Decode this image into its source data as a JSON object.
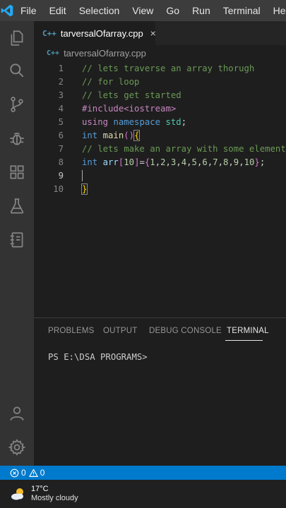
{
  "menu": {
    "items": [
      "File",
      "Edit",
      "Selection",
      "View",
      "Go",
      "Run",
      "Terminal",
      "Help"
    ]
  },
  "activity_bar": {
    "icons": [
      "explorer-icon",
      "search-icon",
      "source-control-icon",
      "run-debug-icon",
      "extensions-icon",
      "testing-icon",
      "notebook-icon"
    ],
    "bottom_icons": [
      "account-icon",
      "settings-gear-icon"
    ]
  },
  "tab": {
    "icon_text": "C++",
    "label": "tarversalOfarray.cpp",
    "close": "×"
  },
  "breadcrumb": {
    "icon_text": "C++",
    "file": "tarversalOfarray.cpp"
  },
  "editor": {
    "active_line": 9,
    "line_numbers": [
      "1",
      "2",
      "3",
      "4",
      "5",
      "6",
      "7",
      "8",
      "9",
      "10"
    ],
    "lines": [
      [
        {
          "t": "// lets traverse an array thorugh",
          "c": "cm"
        }
      ],
      [
        {
          "t": "// for loop",
          "c": "cm"
        }
      ],
      [
        {
          "t": "// lets get started",
          "c": "cm"
        }
      ],
      [
        {
          "t": "#include",
          "c": "pp"
        },
        {
          "t": "<iostream>",
          "c": "pp"
        }
      ],
      [
        {
          "t": "using",
          "c": "pp"
        },
        {
          "t": " ",
          "c": "pu"
        },
        {
          "t": "namespace",
          "c": "kw"
        },
        {
          "t": " ",
          "c": "pu"
        },
        {
          "t": "std",
          "c": "ty"
        },
        {
          "t": ";",
          "c": "pu"
        }
      ],
      [
        {
          "t": "int",
          "c": "kw"
        },
        {
          "t": " ",
          "c": "pu"
        },
        {
          "t": "main",
          "c": "fn"
        },
        {
          "t": "()",
          "c": "bb"
        },
        {
          "t": "{",
          "c": "br"
        }
      ],
      [
        {
          "t": "// lets make an array with some elements",
          "c": "cm"
        }
      ],
      [
        {
          "t": "int",
          "c": "kw"
        },
        {
          "t": " ",
          "c": "pu"
        },
        {
          "t": "arr",
          "c": "id"
        },
        {
          "t": "[",
          "c": "bb"
        },
        {
          "t": "10",
          "c": "nu"
        },
        {
          "t": "]",
          "c": "bb"
        },
        {
          "t": "=",
          "c": "pu"
        },
        {
          "t": "{",
          "c": "bb"
        },
        {
          "t": "1",
          "c": "nu"
        },
        {
          "t": ",",
          "c": "pu"
        },
        {
          "t": "2",
          "c": "nu"
        },
        {
          "t": ",",
          "c": "pu"
        },
        {
          "t": "3",
          "c": "nu"
        },
        {
          "t": ",",
          "c": "pu"
        },
        {
          "t": "4",
          "c": "nu"
        },
        {
          "t": ",",
          "c": "pu"
        },
        {
          "t": "5",
          "c": "nu"
        },
        {
          "t": ",",
          "c": "pu"
        },
        {
          "t": "6",
          "c": "nu"
        },
        {
          "t": ",",
          "c": "pu"
        },
        {
          "t": "7",
          "c": "nu"
        },
        {
          "t": ",",
          "c": "pu"
        },
        {
          "t": "8",
          "c": "nu"
        },
        {
          "t": ",",
          "c": "pu"
        },
        {
          "t": "9",
          "c": "nu"
        },
        {
          "t": ",",
          "c": "pu"
        },
        {
          "t": "10",
          "c": "nu"
        },
        {
          "t": "}",
          "c": "bb"
        },
        {
          "t": ";",
          "c": "pu"
        }
      ],
      [
        {
          "t": "",
          "c": "pu"
        }
      ],
      [
        {
          "t": "}",
          "c": "br"
        }
      ]
    ]
  },
  "panel": {
    "tabs": [
      "PROBLEMS",
      "OUTPUT",
      "DEBUG CONSOLE",
      "TERMINAL"
    ],
    "active_tab": "TERMINAL",
    "terminal_prompt": "PS E:\\DSA PROGRAMS>"
  },
  "status": {
    "errors": "0",
    "warnings": "0"
  },
  "taskbar": {
    "temperature": "17°C",
    "weather": "Mostly cloudy"
  },
  "colors": {
    "accent": "#007acc",
    "comment": "#6a9955",
    "keyword": "#569cd6"
  }
}
